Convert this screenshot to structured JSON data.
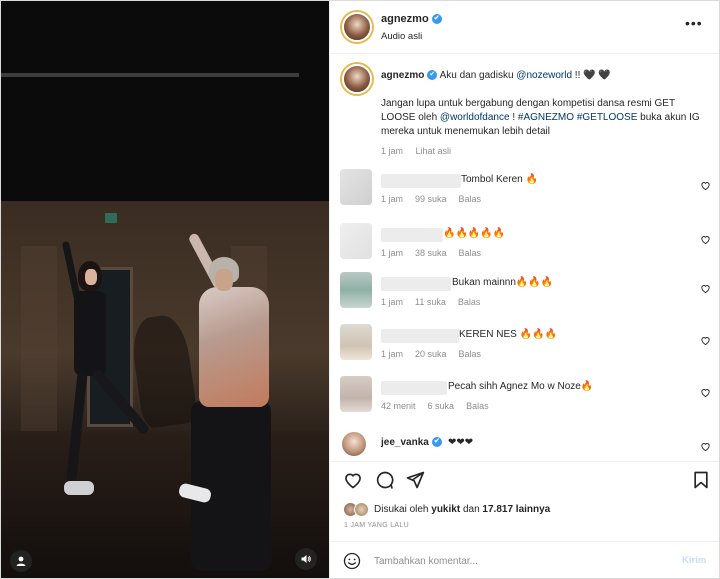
{
  "post": {
    "username": "agnezmo",
    "verified_mark": "✔",
    "audio_label": "Audio asli",
    "more_icon": "more-horizontal-icon",
    "more_glyph": "•••"
  },
  "caption": {
    "username": "agnezmo",
    "intro_text": " Aku dan gadisku ",
    "intro_mention": "@nozeworld",
    "intro_suffix": " !! 🖤 🖤",
    "body_1": "Jangan lupa untuk bergabung dengan kompetisi dansa resmi GET LOOSE oleh ",
    "body_mention": "@worldofdance",
    "body_2": " ! ",
    "tag_1": "#AGNEZMO",
    "tag_2": "#GETLOOSE",
    "body_3": " buka akun IG mereka untuk menemukan lebih detail",
    "time": "1 jam",
    "translate": "Lihat asli"
  },
  "comments": [
    {
      "text": "Tombol Keren 🔥",
      "time": "1 jam",
      "likes": "99 suka",
      "reply": "Balas",
      "avatar_color": "#d9d9d9"
    },
    {
      "text": "🔥🔥🔥🔥🔥",
      "time": "1 jam",
      "likes": "38 suka",
      "reply": "Balas",
      "avatar_color": "#e6e6e6"
    },
    {
      "text": "Bukan mainnn🔥🔥🔥",
      "time": "1 jam",
      "likes": "11 suka",
      "reply": "Balas",
      "avatar_color": "#9fb8b2"
    },
    {
      "text": "KEREN NES 🔥🔥🔥",
      "time": "1 jam",
      "likes": "20 suka",
      "reply": "Balas",
      "avatar_color": "#dcd2c6"
    },
    {
      "text": "Pecah sihh Agnez Mo w Noze🔥",
      "time": "42 menit",
      "likes": "6 suka",
      "reply": "Balas",
      "avatar_color": "#cfc6c0"
    }
  ],
  "last_comment": {
    "username": "jee_vanka",
    "text": "❤❤❤"
  },
  "actions": {
    "like_icon": "heart-icon",
    "comment_icon": "comment-icon",
    "share_icon": "send-icon",
    "save_icon": "bookmark-icon"
  },
  "likes": {
    "prefix": "Disukai oleh ",
    "user": "yukikt",
    "middle": " dan ",
    "count": "17.817 lainnya"
  },
  "timestamp": "1 jam yang lalu",
  "composer": {
    "placeholder": "Tambahkan komentar...",
    "send_label": "Kirim",
    "emoji_icon": "emoji-icon"
  },
  "colors": {
    "link": "#00376b",
    "verified": "#3897f0",
    "muted": "#8e8e8e",
    "send_disabled": "#c0dffd"
  }
}
